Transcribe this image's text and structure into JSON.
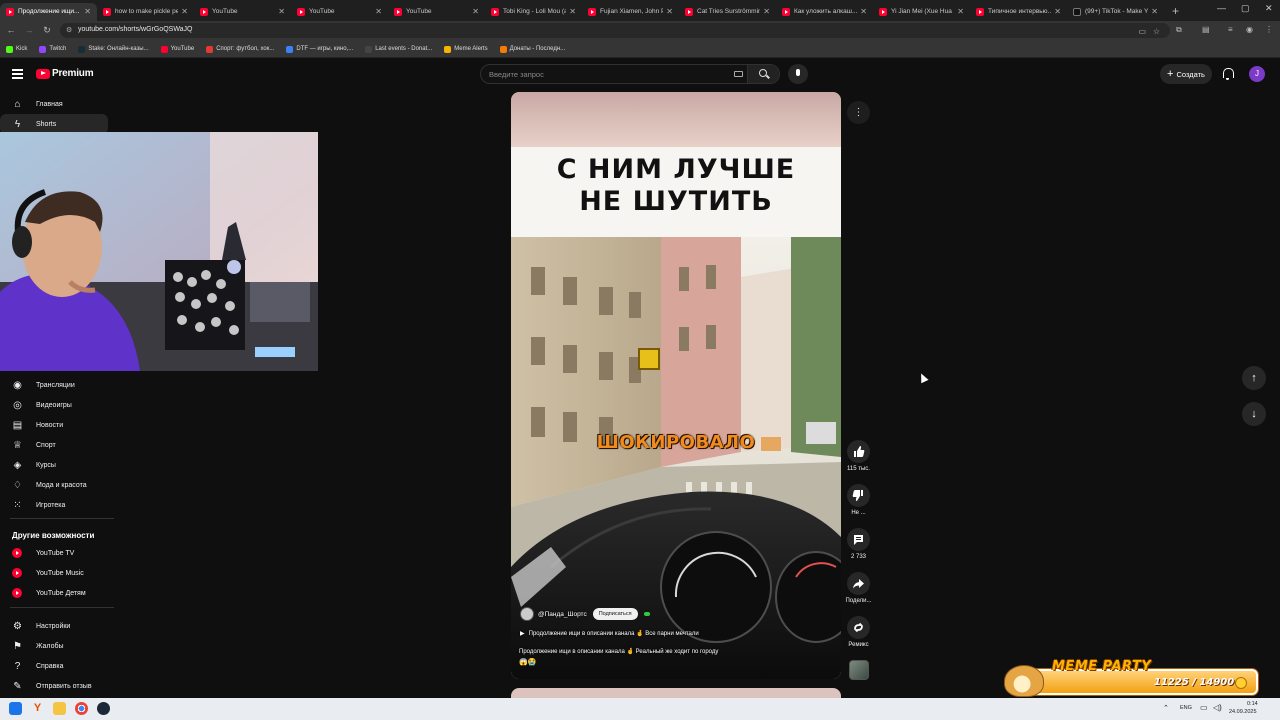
{
  "browser": {
    "tabs": [
      {
        "label": "Продолжение ищи..."
      },
      {
        "label": "how to make pickle pe..."
      },
      {
        "label": "YouTube"
      },
      {
        "label": "YouTube"
      },
      {
        "label": "YouTube"
      },
      {
        "label": "Tobi King - Loli Mou (a..."
      },
      {
        "label": "Fujian Xiamen, John Pe..."
      },
      {
        "label": "Cat Tries Surströmming..."
      },
      {
        "label": "Как уложить алкаш..."
      },
      {
        "label": "Yi Jian Mei (Xue Hua P..."
      },
      {
        "label": "Типичное интервью..."
      },
      {
        "label": "(99+) TikTok - Make Yo..."
      }
    ],
    "url": "youtube.com/shorts/wGrGoQSWaJQ",
    "bookmarks": [
      {
        "label": "Kick",
        "color": "#53fc18"
      },
      {
        "label": "Twitch",
        "color": "#9146ff"
      },
      {
        "label": "Stake: Онлайн-казы...",
        "color": "#1a2c38"
      },
      {
        "label": "YouTube",
        "color": "#ff0033"
      },
      {
        "label": "Спорт: футбол, хок...",
        "color": "#e53935"
      },
      {
        "label": "DTF — игры, кино,...",
        "color": "#3b82f6"
      },
      {
        "label": "Last events - Donat...",
        "color": "#444444"
      },
      {
        "label": "Meme Alerts",
        "color": "#f5b400"
      },
      {
        "label": "Донаты - Последн...",
        "color": "#f57c00"
      }
    ]
  },
  "header": {
    "logo_text": "Premium",
    "search_placeholder": "Введите запрос",
    "create_label": "Создать",
    "avatar_letter": "J"
  },
  "sidebar": {
    "top_items": [
      {
        "label": "Главная",
        "icon": "home-icon"
      },
      {
        "label": "Shorts",
        "icon": "shorts-icon"
      }
    ],
    "explore_items": [
      {
        "label": "Трансляции",
        "icon": "live-icon"
      },
      {
        "label": "Видеоигры",
        "icon": "gaming-icon"
      },
      {
        "label": "Новости",
        "icon": "news-icon"
      },
      {
        "label": "Спорт",
        "icon": "trophy-icon"
      },
      {
        "label": "Курсы",
        "icon": "courses-icon"
      },
      {
        "label": "Мода и красота",
        "icon": "fashion-icon"
      },
      {
        "label": "Игротека",
        "icon": "playables-icon"
      }
    ],
    "more_heading": "Другие возможности",
    "more_items": [
      {
        "label": "YouTube TV"
      },
      {
        "label": "YouTube Music"
      },
      {
        "label": "YouTube Детям"
      }
    ],
    "footer_items": [
      {
        "label": "Настройки",
        "icon": "gear-icon"
      },
      {
        "label": "Жалобы",
        "icon": "flag-icon"
      },
      {
        "label": "Справка",
        "icon": "help-icon"
      },
      {
        "label": "Отправить отзыв",
        "icon": "feedback-icon"
      }
    ]
  },
  "short": {
    "title_line1": "С НИМ ЛУЧШЕ",
    "title_line2": "НЕ ШУТИТЬ",
    "overlay": "ШОКИРОВАЛО",
    "channel": "@Панда_Шортс",
    "subscribe": "Подписаться",
    "playlist": "Продолжение ищи в описании канала 🤞 Все парни мечтали",
    "description": "Продолжение ищи в описании канала 🤞 Реальный же ходит по городу",
    "emojis": "😱😭"
  },
  "actions": {
    "likes": "115 тыс.",
    "dislike_label": "Не ...",
    "comments": "2 733",
    "share_label": "Подели...",
    "remix_label": "Ремикс"
  },
  "overlay": {
    "title": "MEME PARTY",
    "count": "11225 / 14900"
  },
  "taskbar": {
    "lang": "ENG",
    "time": "0:14",
    "date": "24.09.2025"
  }
}
